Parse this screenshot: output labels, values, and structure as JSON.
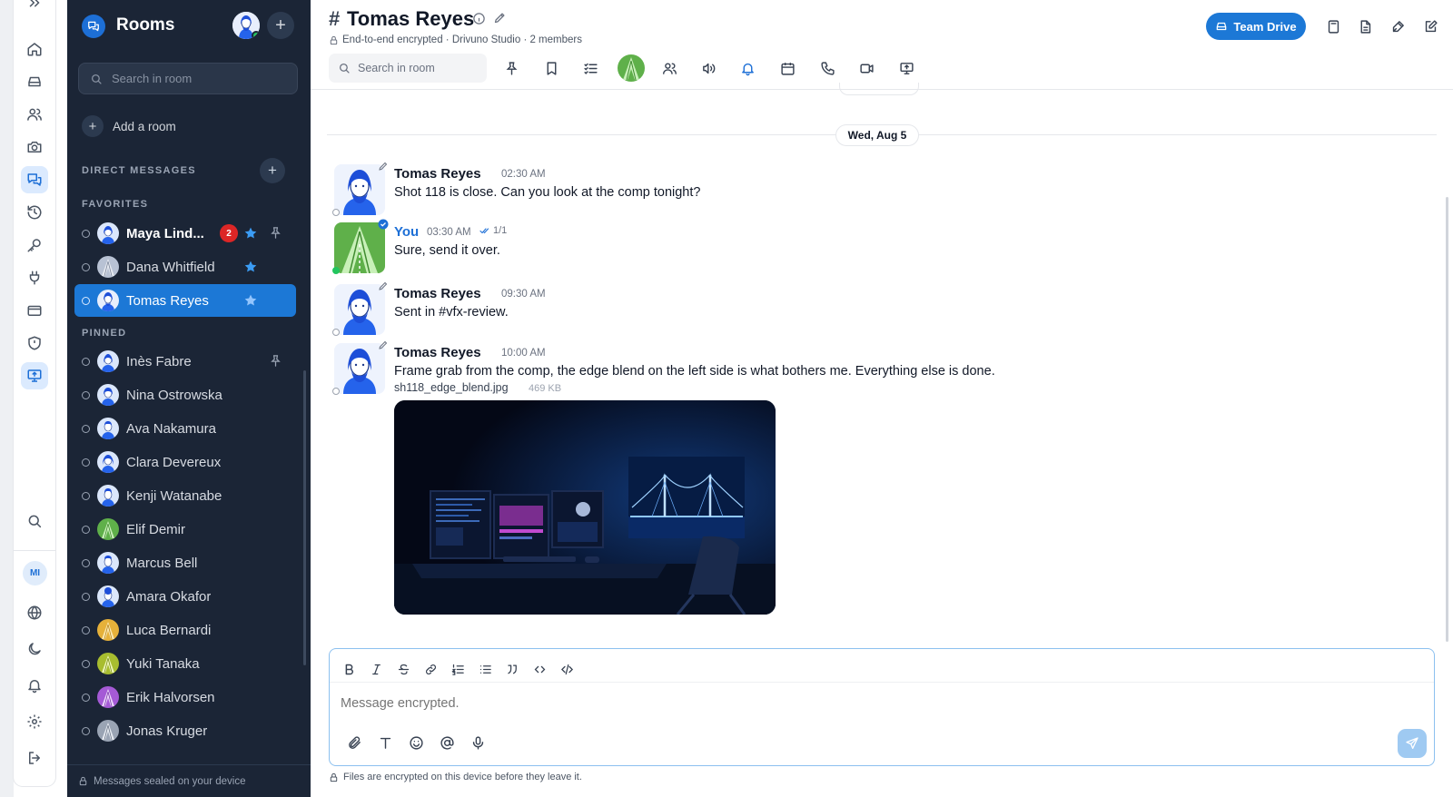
{
  "sidebar": {
    "title": "Rooms",
    "search_placeholder": "Search in room",
    "add_room_label": "Add a room",
    "sections": {
      "direct_messages": "DIRECT MESSAGES",
      "favorites": "FAVORITES",
      "pinned": "PINNED"
    },
    "favorites": [
      {
        "name": "Maya Lind...",
        "badge": "2",
        "starred": true,
        "pinned": true,
        "unread": true
      },
      {
        "name": "Dana Whitfield",
        "starred": true
      },
      {
        "name": "Tomas Reyes",
        "starred": true,
        "active": true
      }
    ],
    "pinned": [
      {
        "name": "Inès Fabre",
        "pinned": true
      },
      {
        "name": "Nina Ostrowska"
      },
      {
        "name": "Ava Nakamura"
      },
      {
        "name": "Clara Devereux"
      },
      {
        "name": "Kenji Watanabe"
      },
      {
        "name": "Elif Demir"
      },
      {
        "name": "Marcus Bell"
      },
      {
        "name": "Amara Okafor"
      },
      {
        "name": "Luca Bernardi"
      },
      {
        "name": "Yuki Tanaka"
      },
      {
        "name": "Erik Halvorsen"
      },
      {
        "name": "Jonas Kruger"
      }
    ],
    "footer": "Messages sealed on your device"
  },
  "rail": {
    "user_initials": "MI"
  },
  "header": {
    "hash": "#",
    "title": "Tomas Reyes",
    "subtitle": "End-to-end encrypted · Drivuno Studio · 2 members",
    "search_placeholder": "Search in room",
    "team_drive_label": "Team Drive"
  },
  "timeline": {
    "date_label": "Wed, Aug 5",
    "messages": [
      {
        "author": "Tomas Reyes",
        "time": "02:30 AM",
        "text": "Shot 118 is close. Can you look at the comp tonight?"
      },
      {
        "author": "You",
        "time": "03:30 AM",
        "read": "1/1",
        "text": "Sure, send it over."
      },
      {
        "author": "Tomas Reyes",
        "time": "09:30 AM",
        "text": "Sent in #vfx-review."
      },
      {
        "author": "Tomas Reyes",
        "time": "10:00 AM",
        "text": "Frame grab from the comp, the edge blend on the left side is what bothers me. Everything else is done.",
        "attachment": {
          "name": "sh118_edge_blend.jpg",
          "size": "469 KB"
        }
      }
    ]
  },
  "composer": {
    "placeholder": "Message encrypted.",
    "footer": "Files are encrypted on this device before they leave it."
  },
  "colors": {
    "accent": "#1c78d6",
    "sidebar_bg": "#1b2536",
    "badge": "#dc2626",
    "online": "#22c55e"
  }
}
